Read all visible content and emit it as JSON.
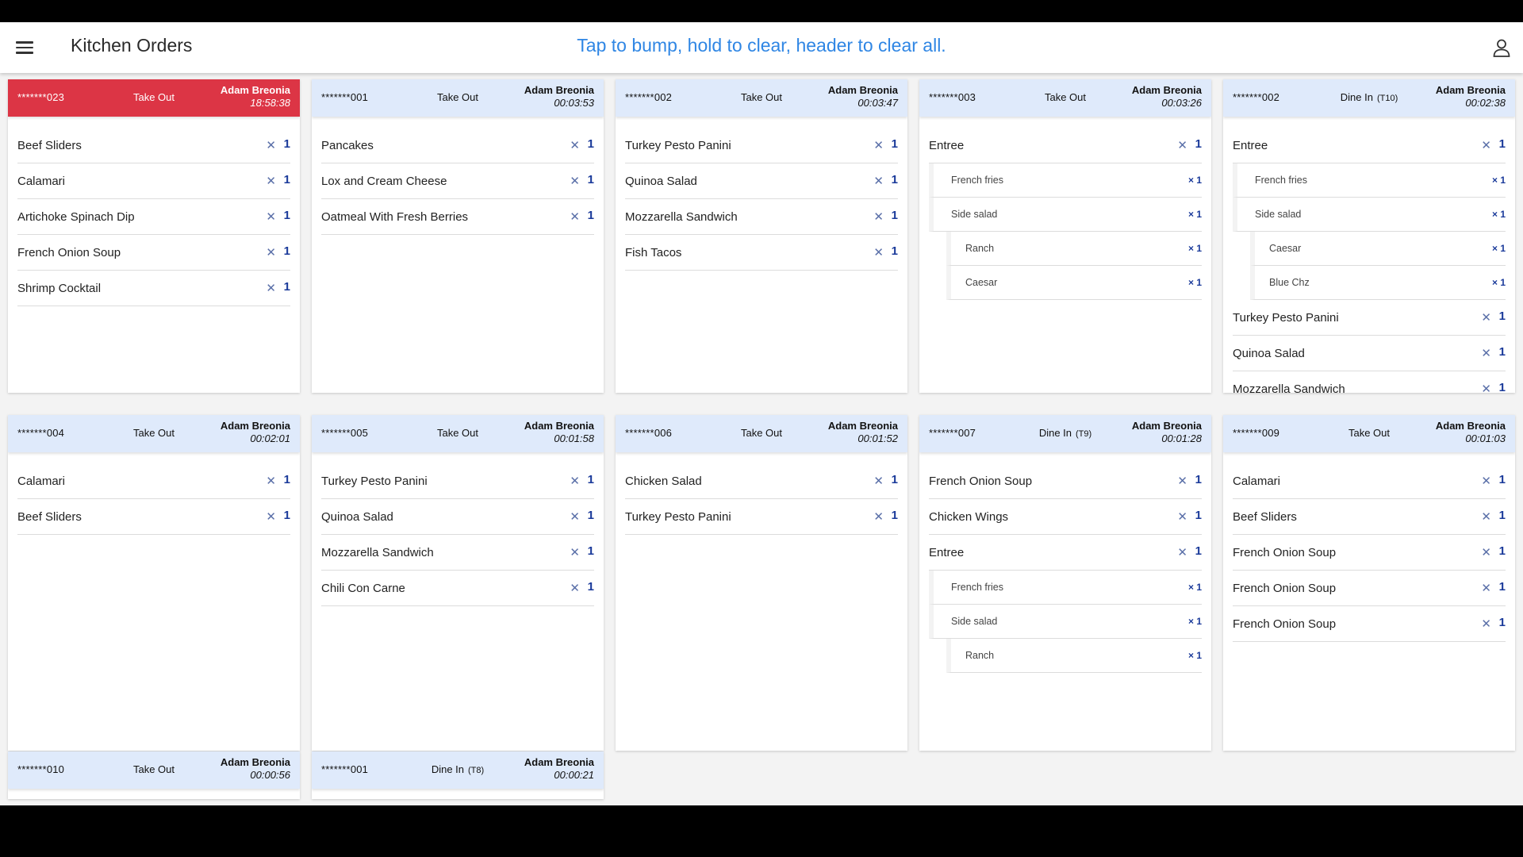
{
  "app": {
    "title": "Kitchen Orders",
    "hint": "Tap to bump, hold to clear, header to clear all.",
    "hint_color": "#2f86e4",
    "alert_color": "#dc3545",
    "header_color": "#dfeafb",
    "menu_icon": "hamburger-menu-icon",
    "user_icon": "user-account-icon"
  },
  "orders": [
    {
      "number": "*******023",
      "type": "Take Out",
      "server": "Adam Breonia",
      "time": "18:58:38",
      "alert": true,
      "items": [
        {
          "name": "Beef Sliders",
          "qty": "1"
        },
        {
          "name": "Calamari",
          "qty": "1"
        },
        {
          "name": "Artichoke Spinach Dip",
          "qty": "1"
        },
        {
          "name": "French Onion Soup",
          "qty": "1"
        },
        {
          "name": "Shrimp Cocktail",
          "qty": "1"
        }
      ]
    },
    {
      "number": "*******001",
      "type": "Take Out",
      "server": "Adam Breonia",
      "time": "00:03:53",
      "items": [
        {
          "name": "Pancakes",
          "qty": "1"
        },
        {
          "name": "Lox and Cream Cheese",
          "qty": "1"
        },
        {
          "name": "Oatmeal With Fresh Berries",
          "qty": "1"
        }
      ]
    },
    {
      "number": "*******002",
      "type": "Take Out",
      "server": "Adam Breonia",
      "time": "00:03:47",
      "items": [
        {
          "name": "Turkey Pesto Panini",
          "qty": "1"
        },
        {
          "name": "Quinoa Salad",
          "qty": "1"
        },
        {
          "name": "Mozzarella Sandwich",
          "qty": "1"
        },
        {
          "name": "Fish Tacos",
          "qty": "1"
        }
      ]
    },
    {
      "number": "*******003",
      "type": "Take Out",
      "server": "Adam Breonia",
      "time": "00:03:26",
      "items": [
        {
          "name": "Entree",
          "qty": "1"
        },
        {
          "name": "French fries",
          "qty": "× 1",
          "level": 1
        },
        {
          "name": "Side salad",
          "qty": "× 1",
          "level": 1
        },
        {
          "name": "Ranch",
          "qty": "× 1",
          "level": 2
        },
        {
          "name": "Caesar",
          "qty": "× 1",
          "level": 2
        }
      ]
    },
    {
      "number": "*******002",
      "type": "Dine In",
      "table": "(T10)",
      "server": "Adam Breonia",
      "time": "00:02:38",
      "items": [
        {
          "name": "Entree",
          "qty": "1"
        },
        {
          "name": "French fries",
          "qty": "× 1",
          "level": 1
        },
        {
          "name": "Side salad",
          "qty": "× 1",
          "level": 1
        },
        {
          "name": "Caesar",
          "qty": "× 1",
          "level": 2
        },
        {
          "name": "Blue Chz",
          "qty": "× 1",
          "level": 2
        },
        {
          "name": "Turkey Pesto Panini",
          "qty": "1"
        },
        {
          "name": "Quinoa Salad",
          "qty": "1"
        },
        {
          "name": "Mozzarella Sandwich",
          "qty": "1"
        }
      ]
    },
    {
      "number": "*******004",
      "type": "Take Out",
      "server": "Adam Breonia",
      "time": "00:02:01",
      "items": [
        {
          "name": "Calamari",
          "qty": "1"
        },
        {
          "name": "Beef Sliders",
          "qty": "1"
        }
      ]
    },
    {
      "number": "*******005",
      "type": "Take Out",
      "server": "Adam Breonia",
      "time": "00:01:58",
      "items": [
        {
          "name": "Turkey Pesto Panini",
          "qty": "1"
        },
        {
          "name": "Quinoa Salad",
          "qty": "1"
        },
        {
          "name": "Mozzarella Sandwich",
          "qty": "1"
        },
        {
          "name": "Chili Con Carne",
          "qty": "1"
        }
      ]
    },
    {
      "number": "*******006",
      "type": "Take Out",
      "server": "Adam Breonia",
      "time": "00:01:52",
      "items": [
        {
          "name": "Chicken Salad",
          "qty": "1"
        },
        {
          "name": "Turkey Pesto Panini",
          "qty": "1"
        }
      ]
    },
    {
      "number": "*******007",
      "type": "Dine In",
      "table": "(T9)",
      "server": "Adam Breonia",
      "time": "00:01:28",
      "items": [
        {
          "name": "French Onion Soup",
          "qty": "1"
        },
        {
          "name": "Chicken Wings",
          "qty": "1"
        },
        {
          "name": "Entree",
          "qty": "1"
        },
        {
          "name": "French fries",
          "qty": "× 1",
          "level": 1
        },
        {
          "name": "Side salad",
          "qty": "× 1",
          "level": 1
        },
        {
          "name": "Ranch",
          "qty": "× 1",
          "level": 2
        }
      ]
    },
    {
      "number": "*******009",
      "type": "Take Out",
      "server": "Adam Breonia",
      "time": "00:01:03",
      "items": [
        {
          "name": "Calamari",
          "qty": "1"
        },
        {
          "name": "Beef Sliders",
          "qty": "1"
        },
        {
          "name": "French Onion Soup",
          "qty": "1"
        },
        {
          "name": "French Onion Soup",
          "qty": "1"
        },
        {
          "name": "French Onion Soup",
          "qty": "1"
        }
      ]
    },
    {
      "number": "*******010",
      "type": "Take Out",
      "server": "Adam Breonia",
      "time": "00:00:56",
      "items": []
    },
    {
      "number": "*******001",
      "type": "Dine In",
      "table": "(T8)",
      "server": "Adam Breonia",
      "time": "00:00:21",
      "items": []
    }
  ]
}
